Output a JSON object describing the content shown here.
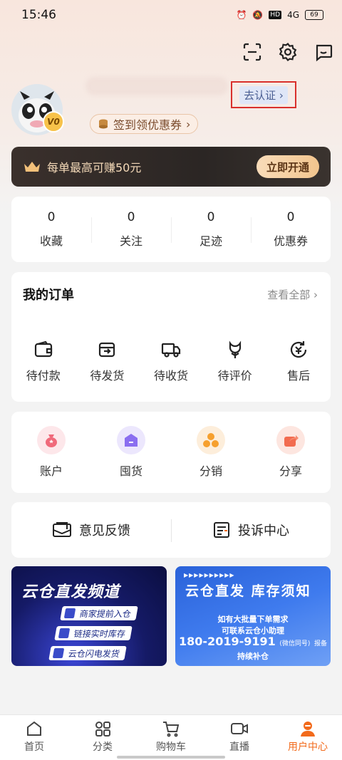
{
  "status": {
    "time": "15:46",
    "network": "4G",
    "battery": "69",
    "hd": "HD"
  },
  "profile": {
    "verify_label": "去认证",
    "signin_label": "签到领优惠券",
    "vip_level": "V0"
  },
  "vip_banner": {
    "text": "每单最高可赚50元",
    "button": "立即开通"
  },
  "stats": [
    {
      "value": "0",
      "label": "收藏"
    },
    {
      "value": "0",
      "label": "关注"
    },
    {
      "value": "0",
      "label": "足迹"
    },
    {
      "value": "0",
      "label": "优惠券"
    }
  ],
  "orders": {
    "title": "我的订单",
    "view_all": "查看全部",
    "items": [
      {
        "label": "待付款",
        "icon": "wallet-icon"
      },
      {
        "label": "待发货",
        "icon": "box-icon"
      },
      {
        "label": "待收货",
        "icon": "truck-icon"
      },
      {
        "label": "待评价",
        "icon": "flower-icon"
      },
      {
        "label": "售后",
        "icon": "refund-icon"
      }
    ]
  },
  "features": [
    {
      "label": "账户",
      "icon": "moneybag-icon",
      "color": "#f0697a"
    },
    {
      "label": "囤货",
      "icon": "warehouse-icon",
      "color": "#8a6ef0"
    },
    {
      "label": "分销",
      "icon": "coins-icon",
      "color": "#f6a02e"
    },
    {
      "label": "分享",
      "icon": "share-icon",
      "color": "#f26b4f"
    }
  ],
  "feedback": {
    "feedback_label": "意见反馈",
    "complaint_label": "投诉中心"
  },
  "banner_left": {
    "title": "云仓直发频道",
    "tags": [
      "商家提前入仓",
      "链接实时库存",
      "云仓闪电发货"
    ]
  },
  "banner_right": {
    "dots": "▶▶▶▶▶▶▶▶▶▶",
    "title": "云仓直发 库存须知",
    "line1": "如有大批量下单需求",
    "line2": "可联系云仓小助理",
    "phone": "180-2019-9191",
    "phone_note": "(微信同号)",
    "phone_suffix": "报备",
    "line3": "持续补仓"
  },
  "tabbar": [
    {
      "label": "首页",
      "icon": "home-icon"
    },
    {
      "label": "分类",
      "icon": "grid-icon"
    },
    {
      "label": "购物车",
      "icon": "cart-icon"
    },
    {
      "label": "直播",
      "icon": "live-icon"
    },
    {
      "label": "用户中心",
      "icon": "user-icon",
      "active": true
    }
  ],
  "colors": {
    "accent": "#f26a1b",
    "verify_border": "#d9302c",
    "vip_bg": "#2b2624"
  }
}
